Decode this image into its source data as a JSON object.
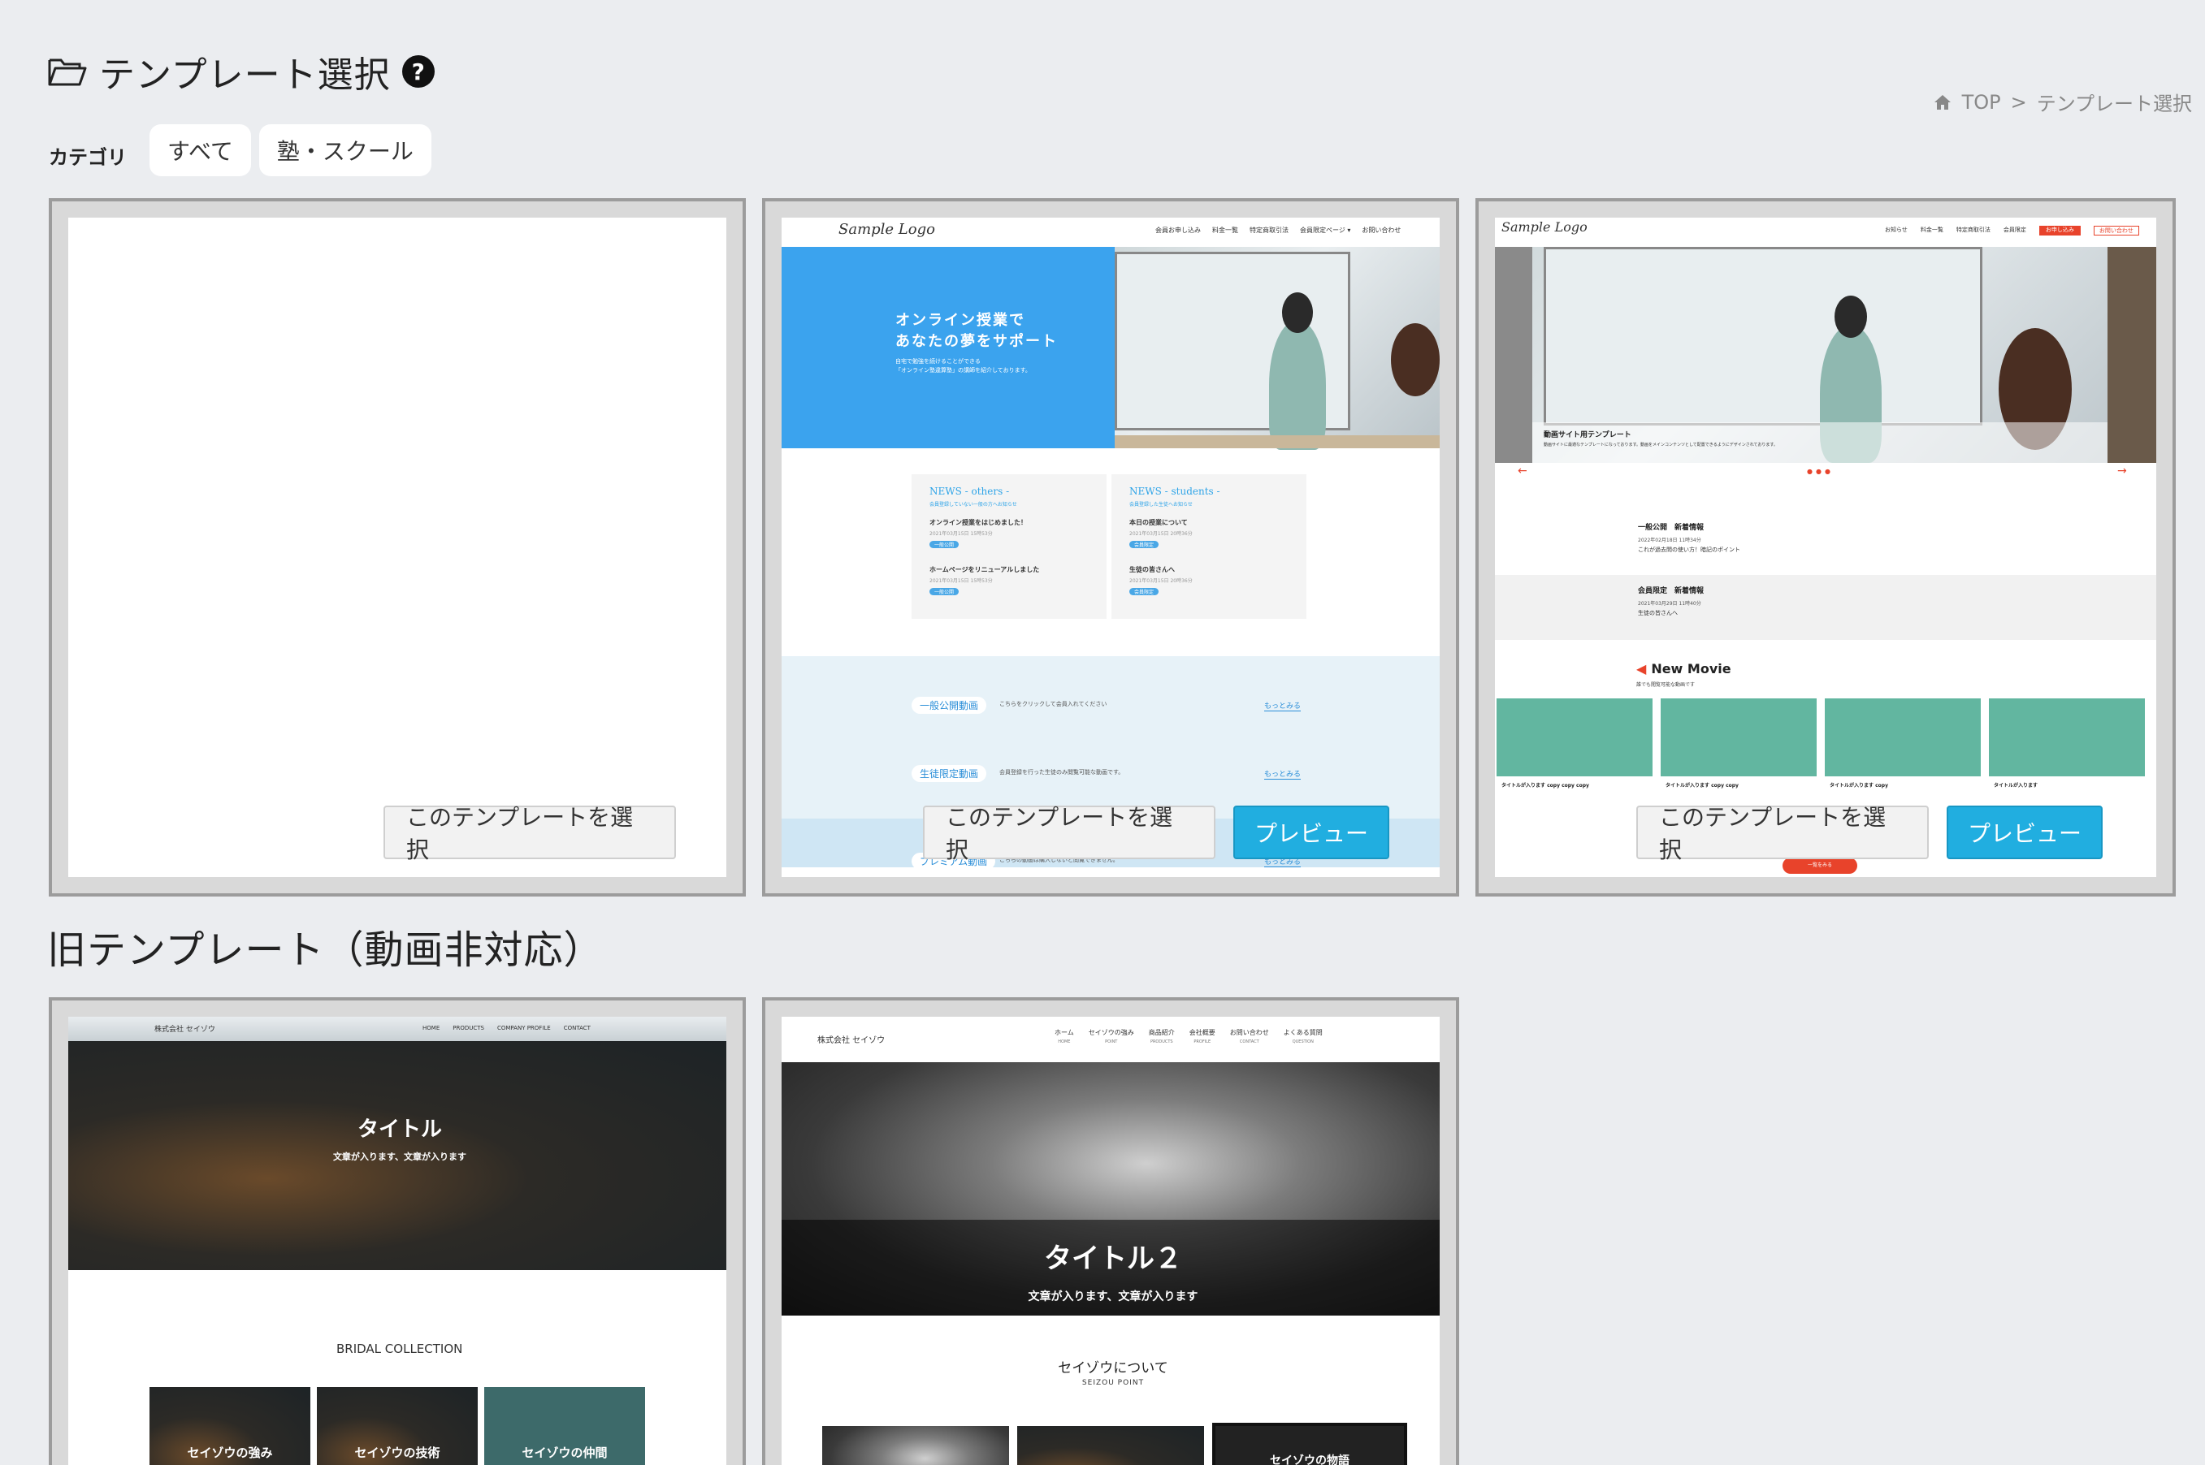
{
  "header": {
    "title": "テンプレート選択",
    "help_glyph": "?"
  },
  "breadcrumb": {
    "home": "TOP",
    "separator": ">",
    "current": "テンプレート選択"
  },
  "category": {
    "label": "カテゴリ",
    "chips": [
      "すべて",
      "塾・スクール"
    ]
  },
  "buttons": {
    "select": "このテンプレートを選択",
    "preview": "プレビュー"
  },
  "templates": {
    "blank": {},
    "school1": {
      "logo": "Sample Logo",
      "nav": [
        "会員お申し込み",
        "料金一覧",
        "特定商取引法",
        "会員限定ページ ▾",
        "お問い合わせ"
      ],
      "hero_line1": "オンライン授業で",
      "hero_line2": "あなたの夢をサポート",
      "hero_sub1": "自宅で勉強を続けることができる",
      "hero_sub2": "「オンライン塾違算塾」の講師を紹介しております。",
      "news_left_title": "NEWS - others -",
      "news_left_sub": "会員登録していない一般の方へお知らせ",
      "news_left_items": [
        "オンライン授業をはじめました！",
        "ホームページをリニューアルしました"
      ],
      "news_left_date": "2021年03月15日 15時53分",
      "news_right_title": "NEWS - students -",
      "news_right_sub": "会員登録した生徒へお知らせ",
      "news_right_items": [
        "本日の授業について",
        "生徒の皆さんへ"
      ],
      "news_right_date": "2021年03月15日 20時36分",
      "tag_left": "一般公開",
      "tag_right": "会員限定",
      "video_rows": [
        {
          "label": "一般公開動画",
          "desc": "こちらをクリックして会員入れてください",
          "more": "もっとみる"
        },
        {
          "label": "生徒限定動画",
          "desc": "会員登録を行った生徒のみ閲覧可能な動画です。",
          "more": "もっとみる"
        },
        {
          "label": "プレミアム動画",
          "desc": "こちらの動画は購入しないと閲覧できません。",
          "more": "もっとみる"
        }
      ]
    },
    "school2": {
      "logo": "Sample Logo",
      "nav": [
        "お知らせ",
        "料金一覧",
        "特定商取引法",
        "会員限定"
      ],
      "nav_btn1": "お申し込み",
      "nav_btn2": "お問い合わせ",
      "caption_title": "動画サイト用テンプレート",
      "caption_text": "動画サイトに最適なテンプレートになっております。動画をメインコンテンツとして配置できるようにデザインされております。",
      "news1_title": "一般公開　新着情報",
      "news1_date": "2022年02月18日 11時34分",
      "news1_text": "これが過去問の使い方！暗記のポイント",
      "news2_title": "会員限定　新着情報",
      "news2_date": "2021年03月29日 11時40分",
      "news2_text": "生徒の皆さんへ",
      "movie_heading": "New Movie",
      "movie_sub": "誰でも閲覧可能な動画です",
      "movie_titles": [
        "タイトルが入ります copy copy copy",
        "タイトルが入ります copy copy",
        "タイトルが入ります copy",
        "タイトルが入ります"
      ],
      "more_btn": "一覧をみる"
    },
    "seizou1": {
      "logo": "株式会社 セイゾウ",
      "nav": [
        "HOME",
        "PRODUCTS",
        "COMPANY PROFILE",
        "CONTACT"
      ],
      "hero_title": "タイトル",
      "hero_sub": "文章が入ります、文章が入ります",
      "collection": "BRIDAL COLLECTION",
      "tiles": [
        "セイゾウの強み",
        "セイゾウの技術",
        "セイゾウの仲間"
      ]
    },
    "seizou2": {
      "logo": "株式会社 セイゾウ",
      "nav": [
        {
          "jp": "ホーム",
          "en": "HOME"
        },
        {
          "jp": "セイゾウの強み",
          "en": "POINT"
        },
        {
          "jp": "商品紹介",
          "en": "PRODUCTS"
        },
        {
          "jp": "会社概要",
          "en": "PROFILE"
        },
        {
          "jp": "お問い合わせ",
          "en": "CONTACT"
        },
        {
          "jp": "よくある質問",
          "en": "QUESTION"
        }
      ],
      "hero_title": "タイトル２",
      "hero_sub": "文章が入ります、文章が入ります",
      "about": "セイゾウについて",
      "about_en": "SEIZOU POINT",
      "tile3": "セイゾウの物語"
    }
  },
  "legacy_section": {
    "title": "旧テンプレート（動画非対応）"
  },
  "colors": {
    "accent": "#21aee0",
    "hero_blue": "#3ba3ee",
    "red": "#e8432b"
  }
}
